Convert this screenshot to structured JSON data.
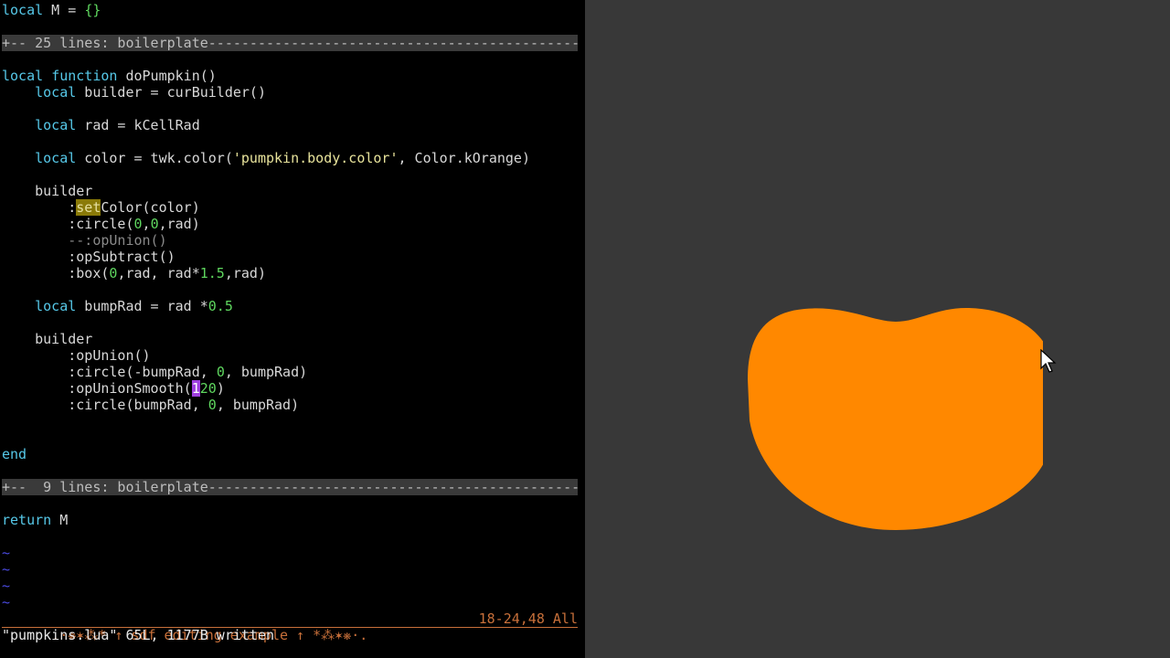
{
  "editor": {
    "lines": [
      {
        "row": 0,
        "segs": [
          {
            "t": "local",
            "c": "kw"
          },
          {
            "t": " M = ",
            "c": ""
          },
          {
            "t": "{}",
            "c": "num"
          }
        ]
      },
      {
        "row": 4,
        "segs": [
          {
            "t": "local",
            "c": "kw"
          },
          {
            "t": " ",
            "c": ""
          },
          {
            "t": "function",
            "c": "kw"
          },
          {
            "t": " doPumpkin()",
            "c": ""
          }
        ]
      },
      {
        "row": 5,
        "segs": [
          {
            "t": "    ",
            "c": ""
          },
          {
            "t": "local",
            "c": "kw"
          },
          {
            "t": " builder = curBuilder()",
            "c": ""
          }
        ]
      },
      {
        "row": 7,
        "segs": [
          {
            "t": "    ",
            "c": ""
          },
          {
            "t": "local",
            "c": "kw"
          },
          {
            "t": " rad = kCellRad",
            "c": ""
          }
        ]
      },
      {
        "row": 9,
        "segs": [
          {
            "t": "    ",
            "c": ""
          },
          {
            "t": "local",
            "c": "kw"
          },
          {
            "t": " color = twk.color(",
            "c": ""
          },
          {
            "t": "'pumpkin.body.color'",
            "c": "str"
          },
          {
            "t": ", Color.kOrange)",
            "c": ""
          }
        ]
      },
      {
        "row": 11,
        "segs": [
          {
            "t": "    builder",
            "c": ""
          }
        ]
      },
      {
        "row": 12,
        "segs": [
          {
            "t": "        :",
            "c": ""
          },
          {
            "t": "set",
            "c": "hl"
          },
          {
            "t": "Color(color)",
            "c": ""
          }
        ]
      },
      {
        "row": 13,
        "segs": [
          {
            "t": "        :circle(",
            "c": ""
          },
          {
            "t": "0",
            "c": "num"
          },
          {
            "t": ",",
            "c": ""
          },
          {
            "t": "0",
            "c": "num"
          },
          {
            "t": ",rad)",
            "c": ""
          }
        ]
      },
      {
        "row": 14,
        "segs": [
          {
            "t": "        --:opUnion()",
            "c": "cmt"
          }
        ]
      },
      {
        "row": 15,
        "segs": [
          {
            "t": "        :opSubtract()",
            "c": ""
          }
        ]
      },
      {
        "row": 16,
        "segs": [
          {
            "t": "        :box(",
            "c": ""
          },
          {
            "t": "0",
            "c": "num"
          },
          {
            "t": ",rad, rad*",
            "c": ""
          },
          {
            "t": "1.5",
            "c": "num"
          },
          {
            "t": ",rad)",
            "c": ""
          }
        ]
      },
      {
        "row": 18,
        "segs": [
          {
            "t": "    ",
            "c": ""
          },
          {
            "t": "local",
            "c": "kw"
          },
          {
            "t": " bumpRad = rad *",
            "c": ""
          },
          {
            "t": "0.5",
            "c": "num"
          }
        ]
      },
      {
        "row": 20,
        "segs": [
          {
            "t": "    builder",
            "c": ""
          }
        ]
      },
      {
        "row": 21,
        "segs": [
          {
            "t": "        :opUnion()",
            "c": ""
          }
        ]
      },
      {
        "row": 22,
        "segs": [
          {
            "t": "        :circle(-bumpRad, ",
            "c": ""
          },
          {
            "t": "0",
            "c": "num"
          },
          {
            "t": ", bumpRad)",
            "c": ""
          }
        ]
      },
      {
        "row": 23,
        "segs": [
          {
            "t": "        :opUnionSmooth(",
            "c": ""
          },
          {
            "t": "1",
            "c": "cursor"
          },
          {
            "t": "20",
            "c": "num"
          },
          {
            "t": ")",
            "c": ""
          }
        ]
      },
      {
        "row": 24,
        "segs": [
          {
            "t": "        :circle(bumpRad, ",
            "c": ""
          },
          {
            "t": "0",
            "c": "num"
          },
          {
            "t": ", bumpRad)",
            "c": ""
          }
        ]
      },
      {
        "row": 27,
        "segs": [
          {
            "t": "end",
            "c": "kw"
          }
        ]
      },
      {
        "row": 31,
        "segs": [
          {
            "t": "return",
            "c": "kw"
          },
          {
            "t": " M",
            "c": ""
          }
        ]
      },
      {
        "row": 33,
        "segs": [
          {
            "t": "~",
            "c": "tilde"
          }
        ]
      },
      {
        "row": 34,
        "segs": [
          {
            "t": "~",
            "c": "tilde"
          }
        ]
      },
      {
        "row": 35,
        "segs": [
          {
            "t": "~",
            "c": "tilde"
          }
        ]
      },
      {
        "row": 36,
        "segs": [
          {
            "t": "~",
            "c": "tilde"
          }
        ]
      }
    ],
    "folds": [
      {
        "row": 2,
        "text": "+-- 25 lines: boilerplate---------------------------------------------"
      },
      {
        "row": 29,
        "text": "+--  9 lines: boilerplate---------------------------------------------"
      }
    ]
  },
  "statusline": {
    "left": ".·❋✶⁂* ↑ sdf editing example ↑ *⁂✶❋·.",
    "right": "18-24,48 All"
  },
  "cmdline": "\"pumpkins.lua\" 65L, 1177B written",
  "preview": {
    "shape_color": "#ff8800",
    "background": "#383838",
    "pointer_icon": "mouse-pointer-icon"
  }
}
